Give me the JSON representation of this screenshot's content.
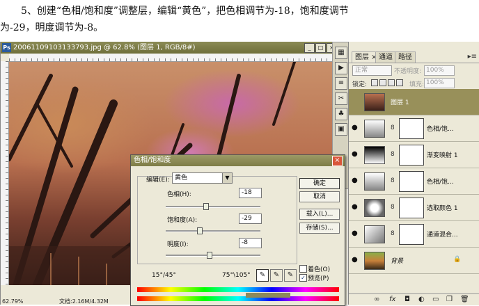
{
  "instruction": {
    "line1": "5、创建“色相/饱和度”调整层，编辑“黄色”，把色相调节为-18，饱和度调节",
    "line2": "为-29，明度调节为-8。"
  },
  "document": {
    "title": "20061109103133793.jpg @ 62.8% (图层 1, RGB/8#)",
    "zoom": "62.79%",
    "doc_size": "文档:2.16M/4.32M"
  },
  "dialog": {
    "title": "色相/饱和度",
    "edit_label": "编辑(E):",
    "edit_value": "黄色",
    "hue_label": "色相(H):",
    "hue_value": "-18",
    "hue_level_pct": 43,
    "sat_label": "饱和度(A):",
    "sat_value": "-29",
    "sat_level_pct": 36,
    "light_label": "明度(I):",
    "light_value": "-8",
    "light_level_pct": 46,
    "ok": "确定",
    "cancel": "取消",
    "load": "载入(L)...",
    "save": "存储(S)...",
    "range_left": "15°/45°",
    "range_right": "75°\\105°",
    "colorize_label": "着色(O)",
    "colorize_checked": false,
    "preview_label": "预览(P)",
    "preview_checked": true
  },
  "layers_panel": {
    "tabs": [
      "图层 ×",
      "通道",
      "路径"
    ],
    "blend_mode": "正常",
    "opacity_label": "不透明度:",
    "opacity_value": "100%",
    "lock_label": "锁定:",
    "fill_label": "填充:",
    "fill_value": "100%",
    "layers": [
      {
        "name": "图层 1",
        "selected": true
      },
      {
        "name": "色相/饱...",
        "selected": false
      },
      {
        "name": "渐变映射 1",
        "selected": false
      },
      {
        "name": "色相/饱...",
        "selected": false
      },
      {
        "name": "选取颜色 1",
        "selected": false
      },
      {
        "name": "通道混合...",
        "selected": false
      },
      {
        "name": "背景",
        "selected": false
      }
    ],
    "bottom_icons": [
      "link-icon",
      "fx-icon",
      "mask-icon",
      "adjustment-icon",
      "folder-icon",
      "new-layer-icon",
      "trash-icon"
    ]
  },
  "colors": {
    "title_olive": "#7e7c46",
    "selected_layer": "#98905a",
    "dialog_bg": "#ECE9D8"
  }
}
